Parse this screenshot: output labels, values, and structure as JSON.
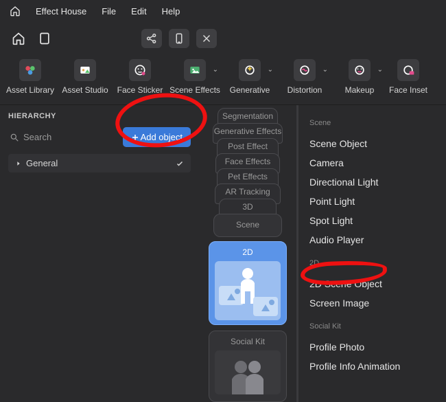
{
  "menu": {
    "items": [
      "Effect House",
      "File",
      "Edit",
      "Help"
    ]
  },
  "tools": [
    {
      "label": "Asset Library"
    },
    {
      "label": "Asset Studio"
    },
    {
      "label": "Face Sticker"
    },
    {
      "label": "Scene Effects",
      "dropdown": true
    },
    {
      "label": "Generative",
      "dropdown": true
    },
    {
      "label": "Distortion",
      "dropdown": true
    },
    {
      "label": "Makeup",
      "dropdown": true
    },
    {
      "label": "Face Inset"
    }
  ],
  "hierarchy": {
    "title": "HIERARCHY",
    "search_placeholder": "Search",
    "add_label": "Add object",
    "tree": {
      "root": "General"
    }
  },
  "stack": {
    "items": [
      "Segmentation",
      "Generative Effects",
      "Post Effect",
      "Face Effects",
      "Pet Effects",
      "AR Tracking",
      "3D",
      "Scene"
    ],
    "selected": "2D",
    "below": "Social Kit"
  },
  "panel": {
    "sections": [
      {
        "title": "Scene",
        "items": [
          "Scene Object",
          "Camera",
          "Directional Light",
          "Point Light",
          "Spot Light",
          "Audio Player"
        ]
      },
      {
        "title": "2D",
        "items": [
          "2D Scene Object",
          "Screen Image"
        ]
      },
      {
        "title": "Social Kit",
        "items": [
          "Profile Photo",
          "Profile Info Animation"
        ]
      }
    ]
  }
}
